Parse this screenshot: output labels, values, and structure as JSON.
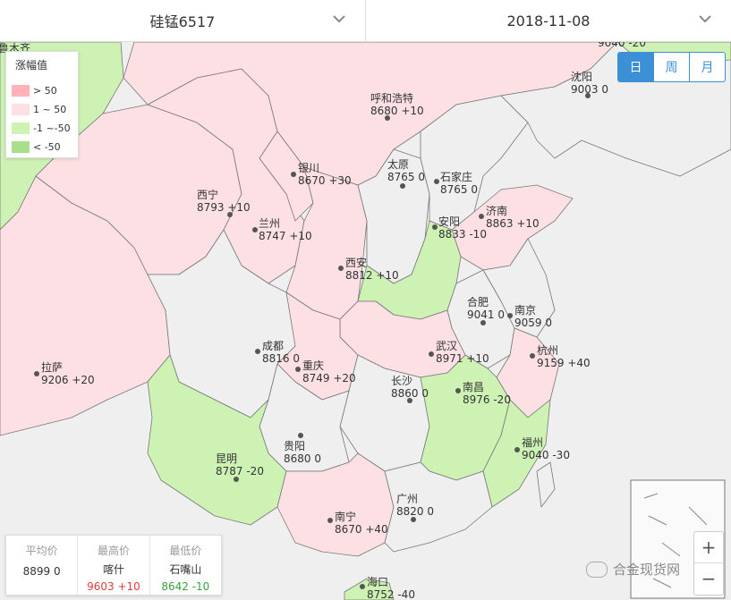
{
  "header": {
    "product": "硅锰6517",
    "date": "2018-11-08"
  },
  "legend": {
    "title": "涨幅值",
    "items": [
      {
        "label": "> 50",
        "color": "#ffb3b8"
      },
      {
        "label": "1 ~ 50",
        "color": "#fde0e4"
      },
      {
        "label": "-1 ~-50",
        "color": "#cdf2b4"
      },
      {
        "label": "< -50",
        "color": "#a9df8b"
      }
    ]
  },
  "period_tabs": [
    {
      "label": "日",
      "active": true
    },
    {
      "label": "周",
      "active": false
    },
    {
      "label": "月",
      "active": false
    }
  ],
  "cities": [
    {
      "name": "呼和浩特",
      "price": "8680 +10"
    },
    {
      "name": "沈阳",
      "price": "9003 0"
    },
    {
      "name": "银川",
      "price": "8670 +30"
    },
    {
      "name": "太原",
      "price": "8765 0"
    },
    {
      "name": "石家庄",
      "price": "8765 0"
    },
    {
      "name": "西宁",
      "price": "8793 +10"
    },
    {
      "name": "兰州",
      "price": "8747 +10"
    },
    {
      "name": "济南",
      "price": "8863 +10"
    },
    {
      "name": "安阳",
      "price": "8833 -10"
    },
    {
      "name": "西安",
      "price": "8812 +10"
    },
    {
      "name": "合肥",
      "price": "9041 0"
    },
    {
      "name": "南京",
      "price": "9059 0"
    },
    {
      "name": "成都",
      "price": "8816 0"
    },
    {
      "name": "武汉",
      "price": "8971 +10"
    },
    {
      "name": "杭州",
      "price": "9159 +40"
    },
    {
      "name": "拉萨",
      "price": "9206 +20"
    },
    {
      "name": "重庆",
      "price": "8749 +20"
    },
    {
      "name": "长沙",
      "price": "8860 0"
    },
    {
      "name": "南昌",
      "price": "8976 -20"
    },
    {
      "name": "贵阳",
      "price": "8680 0"
    },
    {
      "name": "昆明",
      "price": "8787 -20"
    },
    {
      "name": "福州",
      "price": "9040 -30"
    },
    {
      "name": "南宁",
      "price": "8670 +40"
    },
    {
      "name": "广州",
      "price": "8820 0"
    },
    {
      "name": "海口",
      "price": "8752 -40"
    }
  ],
  "partial_labels": {
    "urumqi": "鲁木齐",
    "harbin": "9040 -20"
  },
  "stats": [
    {
      "label": "平均价",
      "city": "",
      "value": "8899 0",
      "color": "#333333"
    },
    {
      "label": "最高价",
      "city": "喀什",
      "value": "9603 +10",
      "color": "#e0403c"
    },
    {
      "label": "最低价",
      "city": "石嘴山",
      "value": "8642 -10",
      "color": "#3aa33a"
    }
  ],
  "zoom": {
    "plus": "+",
    "minus": "−"
  },
  "watermark": "合金现货网",
  "colors": {
    "accent": "#3d8fd6",
    "rise": "#e0403c",
    "fall": "#3aa33a"
  }
}
